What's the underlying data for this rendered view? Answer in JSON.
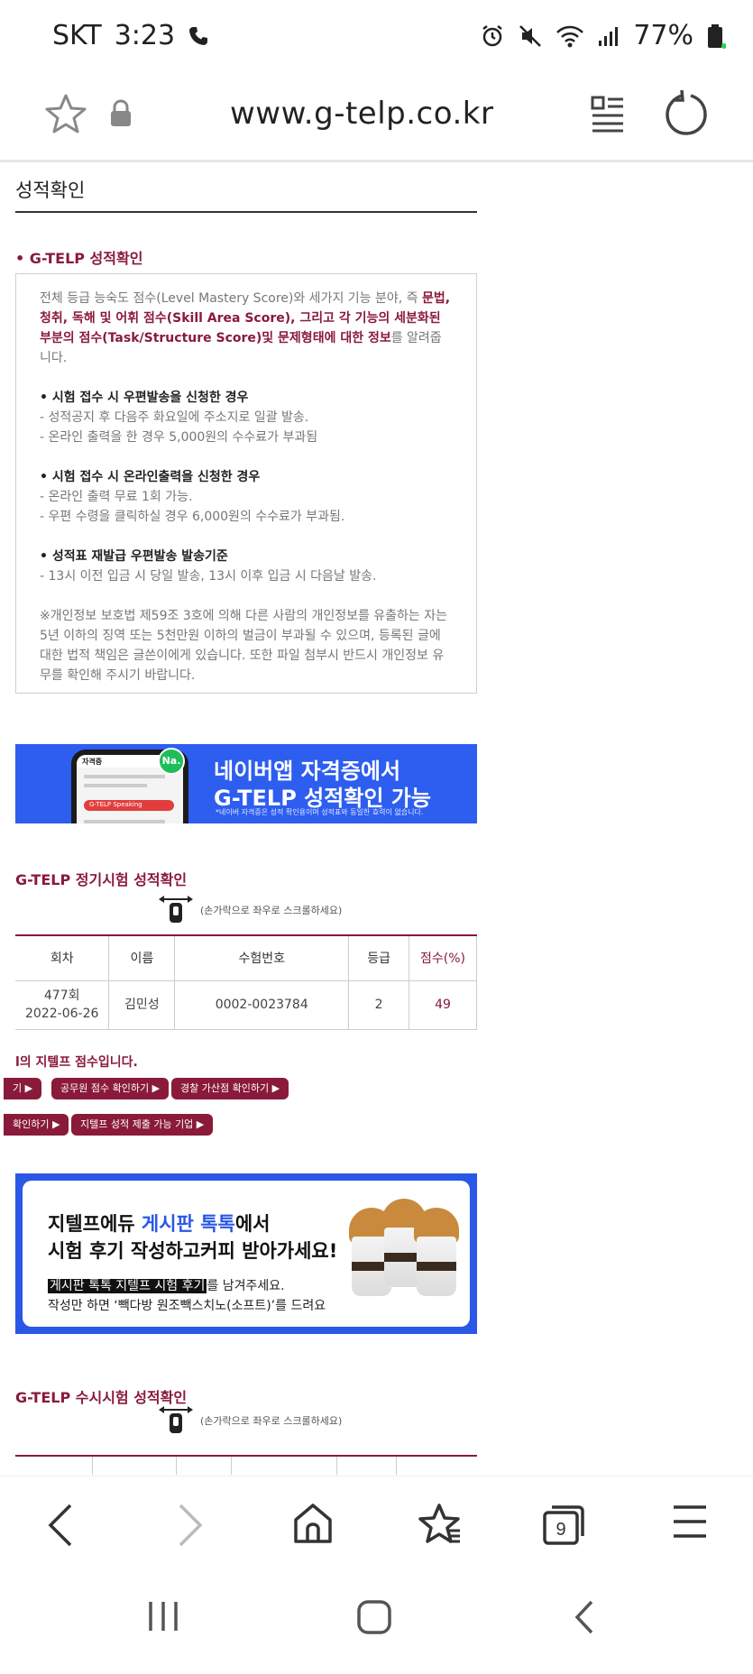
{
  "status_bar": {
    "carrier": "SKT",
    "time": "3:23",
    "battery": "77%"
  },
  "browser": {
    "url": "www.g-telp.co.kr",
    "tab_count": "9"
  },
  "page": {
    "title": "성적확인",
    "section1_title": "• G-TELP 성적확인",
    "intro_pre": "전체 등급 능숙도 점수(Level Mastery Score)와 세가지 기능 분야, 즉 ",
    "intro_em": "문법, 청취, 독해 및 어휘 점수(Skill Area Score), 그리고 각 기능의 세분화된 부분의 점수(Task/Structure Score)및 문제형태에 대한 정보",
    "intro_post": "를 알려줍니다.",
    "postal_title": "• 시험 접수 시 우편발송을 신청한 경우",
    "postal_l1": "- 성적공지 후 다음주 화요일에 주소지로 일괄 발송.",
    "postal_l2": "- 온라인 출력을 한 경우 5,000원의 수수료가 부과됨",
    "online_title": "• 시험 접수 시 온라인출력을 신청한 경우",
    "online_l1": "- 온라인 출력 무료 1회 가능.",
    "online_l2": "- 우편 수령을 클릭하실 경우 6,000원의 수수료가 부과됨.",
    "reissue_title": "• 성적표 재발급 우편발송 발송기준",
    "reissue_l1": "- 13시 이전 입금 시 당일 발송, 13시 이후 입금 시 다음날 발송.",
    "privacy_note": "※개인정보 보호법 제59조 3호에 의해 다른 사람의 개인정보를 유출하는 자는 5년 이하의 징역 또는 5천만원 이하의 벌금이 부과될 수 있으며, 등록된 글에 대한 법적 책임은 글쓴이에게 있습니다. 또한 파일 첨부시 반드시 개인정보 유무를 확인해 주시기 바랍니다.",
    "naver_banner": {
      "line1": "네이버앱 자격증에서",
      "line2": "G-TELP 성적확인 가능",
      "note": "*네이버 자격증은 성적 확인용이며 성적표와 동일한 효력이 없습니다.",
      "badge": "Na.",
      "phone_label": "자격증",
      "phone_item": "G-TELP Speaking"
    },
    "section2_title": "G-TELP 정기시험 성적확인",
    "scroll_hint": "(손가락으로 좌우로 스크롤하세요)",
    "table_headers": [
      "회차",
      "이름",
      "수험번호",
      "등급",
      "점수(%)"
    ],
    "table_row": {
      "round": "477회",
      "date": "2022-06-26",
      "name": "김민성",
      "exam_no": "0002-0023784",
      "grade": "2",
      "score": "49"
    },
    "red_line": "l의 지텔프 점수입니다.",
    "buttons_row1": [
      "기 ▶",
      "공무원 점수 확인하기 ▶",
      "경찰 가산점 확인하기 ▶"
    ],
    "buttons_row2": [
      "확인하기 ▶",
      "지텔프 성적 제출 가능 기업 ▶"
    ],
    "event_banner": {
      "h1_pre": "지텔프에듀 ",
      "h1_blue": "게시판 톡톡",
      "h1_post": "에서",
      "h2": "시험 후기 작성하고커피 받아가세요!",
      "l1_hl": "게시판 톡톡 지텔프 시험 후기",
      "l1_post": "를 남겨주세요.",
      "l2": "작성만 하면 ‘빽다방 원조빽스치노(소프트)’를 드려요"
    },
    "section3_title": "G-TELP 수시시험 성적확인"
  },
  "colors": {
    "brand": "#8a1a3a",
    "banner_blue": "#2d5ef0"
  }
}
